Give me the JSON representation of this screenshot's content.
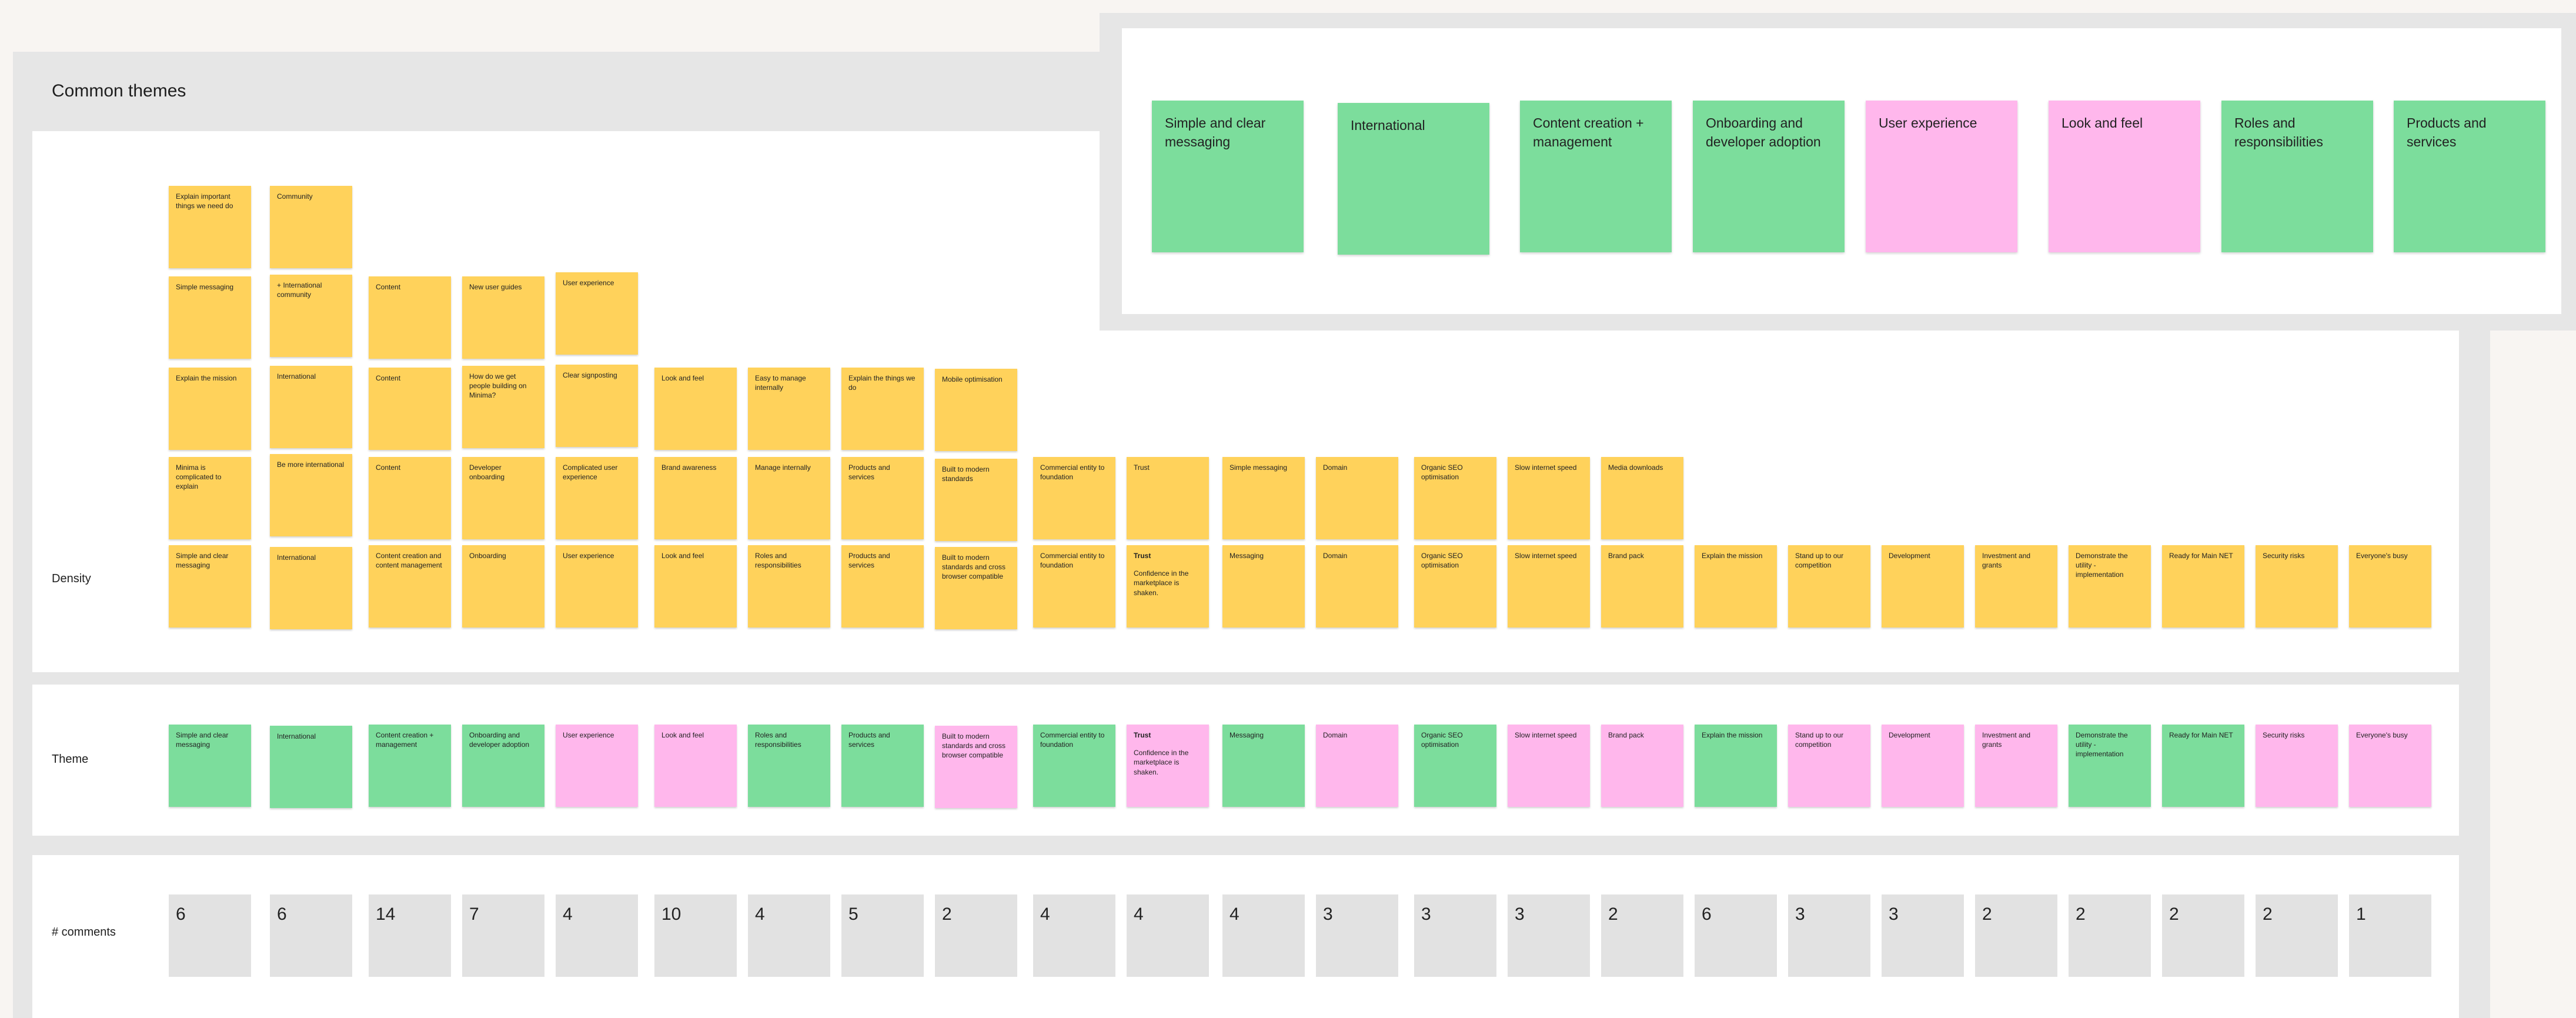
{
  "board": {
    "title": "Common themes",
    "row_labels": {
      "density": "Density",
      "theme": "Theme",
      "comments": "# comments"
    }
  },
  "colors": {
    "yellow": "#ffd25b",
    "green": "#7cdd9c",
    "pink": "#ffb7ec",
    "grey": "#e2e2e2"
  },
  "density": {
    "col1": [
      "Explain important things we need do",
      "Simple messaging",
      "Explain the mission",
      "Minima is complicated to explain",
      "Simple and clear messaging"
    ],
    "col2": [
      "Community",
      "+ International community",
      "International",
      "Be more international",
      "International"
    ],
    "col3": [
      "Content",
      "Content",
      "Content",
      "Content creation and content management"
    ],
    "col4": [
      "New user guides",
      "How do we get people building on Minima?",
      "Developer onboarding",
      "Onboarding"
    ],
    "col5": [
      "User experience",
      "Clear signposting",
      "Complicated user experience",
      "User experience"
    ],
    "col6": [
      "Look and feel",
      "Brand awareness",
      "Look and feel"
    ],
    "col7": [
      "Easy to manage internally",
      "Manage internally",
      "Roles and responsibilities"
    ],
    "col8": [
      "Explain the things we do",
      "Products and services",
      "Products and services"
    ],
    "col9": [
      "Mobile optimisation",
      "Built to modern standards",
      "Built to modern standards and cross browser compatible"
    ],
    "col10": [
      "Commercial entity to foundation",
      "Commercial entity to foundation"
    ],
    "col11": [
      "Trust",
      "Trust",
      "Confidence in the marketplace is shaken."
    ],
    "col12": [
      "Simple messaging",
      "Messaging"
    ],
    "col13": [
      "Domain",
      "Domain"
    ],
    "col14": [
      "Organic SEO optimisation",
      "Organic SEO optimisation"
    ],
    "col15": [
      "Slow internet speed",
      "Slow internet speed"
    ],
    "col16": [
      "Media downloads",
      "Brand pack"
    ],
    "col17": [
      "Explain the mission"
    ],
    "col18": [
      "Stand up to our competition"
    ],
    "col19": [
      "Development"
    ],
    "col20": [
      "Investment and grants"
    ],
    "col21": [
      "Demonstrate the utility - implementation"
    ],
    "col22": [
      "Ready for Main NET"
    ],
    "col23": [
      "Security risks"
    ],
    "col24": [
      "Everyone's busy"
    ]
  },
  "themes": [
    {
      "text": "Simple and clear messaging",
      "color": "green"
    },
    {
      "text": "International",
      "color": "green"
    },
    {
      "text": "Content creation + management",
      "color": "green"
    },
    {
      "text": "Onboarding and developer adoption",
      "color": "green"
    },
    {
      "text": "User experience",
      "color": "pink"
    },
    {
      "text": "Look and feel",
      "color": "pink"
    },
    {
      "text": "Roles and responsibilities",
      "color": "green"
    },
    {
      "text": "Products and services",
      "color": "green"
    },
    {
      "text": "Built to modern standards and cross browser compatible",
      "color": "pink"
    },
    {
      "text": "Commercial entity to foundation",
      "color": "green"
    },
    {
      "text": "Trust",
      "sub": "Confidence in the marketplace is shaken.",
      "color": "pink"
    },
    {
      "text": "Messaging",
      "color": "green"
    },
    {
      "text": "Domain",
      "color": "pink"
    },
    {
      "text": "Organic SEO optimisation",
      "color": "green"
    },
    {
      "text": "Slow internet speed",
      "color": "pink"
    },
    {
      "text": "Brand pack",
      "color": "pink"
    },
    {
      "text": "Explain the mission",
      "color": "green"
    },
    {
      "text": "Stand up to our competition",
      "color": "pink"
    },
    {
      "text": "Development",
      "color": "pink"
    },
    {
      "text": "Investment and grants",
      "color": "pink"
    },
    {
      "text": "Demonstrate the utility - implementation",
      "color": "green"
    },
    {
      "text": "Ready for Main NET",
      "color": "green"
    },
    {
      "text": "Security risks",
      "color": "pink"
    },
    {
      "text": "Everyone's busy",
      "color": "pink"
    }
  ],
  "comments": [
    "6",
    "6",
    "14",
    "7",
    "4",
    "10",
    "4",
    "5",
    "2",
    "4",
    "4",
    "4",
    "3",
    "3",
    "3",
    "2",
    "6",
    "3",
    "3",
    "2",
    "2",
    "2",
    "2",
    "1"
  ],
  "summary": [
    {
      "text": "Simple and clear messaging",
      "color": "green"
    },
    {
      "text": "International",
      "color": "green"
    },
    {
      "text": "Content creation + management",
      "color": "green"
    },
    {
      "text": "Onboarding and developer adoption",
      "color": "green"
    },
    {
      "text": "User experience",
      "color": "pink"
    },
    {
      "text": "Look and feel",
      "color": "pink"
    },
    {
      "text": "Roles and responsibilities",
      "color": "green"
    },
    {
      "text": "Products and services",
      "color": "green"
    }
  ]
}
